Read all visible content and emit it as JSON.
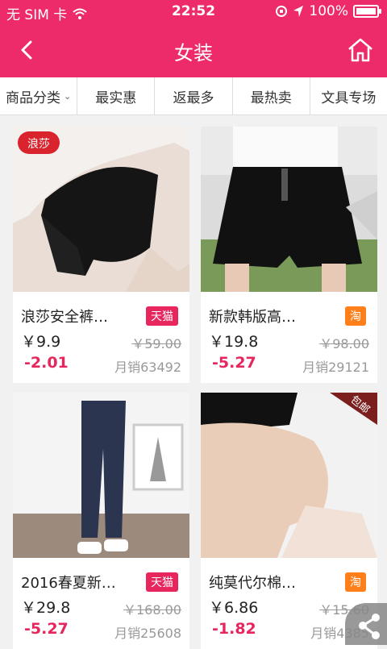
{
  "status": {
    "carrier": "无 SIM 卡",
    "time": "22:52",
    "battery": "100%"
  },
  "navbar": {
    "title": "女装"
  },
  "tabs": [
    {
      "label": "商品分类"
    },
    {
      "label": "最实惠"
    },
    {
      "label": "返最多"
    },
    {
      "label": "最热卖"
    },
    {
      "label": "文具专场"
    }
  ],
  "products": [
    {
      "name": "浪莎安全裤…",
      "badge": "天猫",
      "badge_color": "#e8265e",
      "price": "￥9.9",
      "original": "￥59.00",
      "coupon": "-2.01",
      "sales": "月销63492",
      "logo_text": "浪莎"
    },
    {
      "name": "新款韩版高…",
      "badge": "淘",
      "badge_color": "#ff7f1a",
      "price": "￥19.8",
      "original": "￥98.00",
      "coupon": "-5.27",
      "sales": "月销29121"
    },
    {
      "name": "2016春夏新…",
      "badge": "天猫",
      "badge_color": "#e8265e",
      "price": "￥29.8",
      "original": "￥168.00",
      "coupon": "-5.27",
      "sales": "月销25608"
    },
    {
      "name": "纯莫代尔棉…",
      "badge": "淘",
      "badge_color": "#ff7f1a",
      "price": "￥6.86",
      "original": "￥15.60",
      "coupon": "-1.82",
      "sales": "月销4385",
      "ribbon": "包邮"
    }
  ]
}
